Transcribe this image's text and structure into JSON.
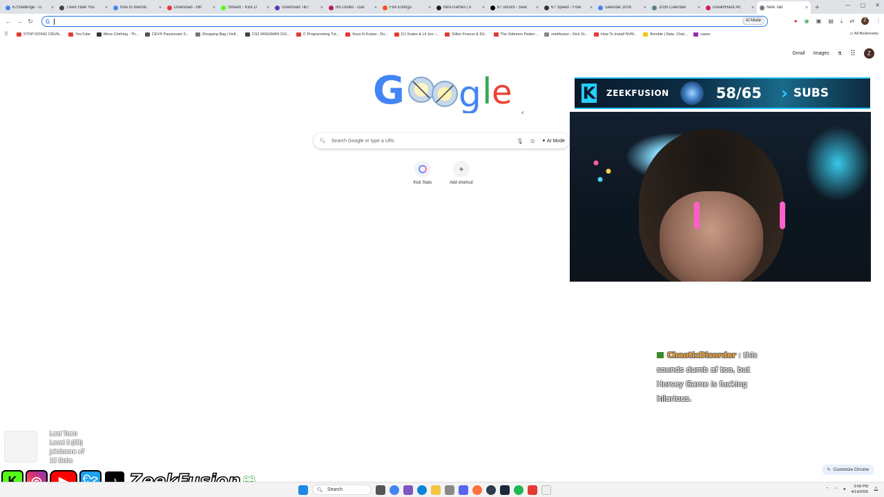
{
  "browser": {
    "tabs": [
      {
        "title": "67challenge - G",
        "color": "#4285f4"
      },
      {
        "title": "Trees Hate You",
        "color": "#444"
      },
      {
        "title": "how to downlo",
        "color": "#4285f4"
      },
      {
        "title": "Download - Mil",
        "color": "#e53935"
      },
      {
        "title": "Stream - Kick D",
        "color": "#53fc18"
      },
      {
        "title": "Download TikT",
        "color": "#5e35b1"
      },
      {
        "title": "IRLToolkit - Das",
        "color": "#c2185b"
      },
      {
        "title": "Fire Extingu",
        "color": "#f4511e"
      },
      {
        "title": "Mini-Games | k",
        "color": "#222"
      },
      {
        "title": "67 record - Sear",
        "color": "#000"
      },
      {
        "title": "67 Speed - Free",
        "color": "#333"
      },
      {
        "title": "calendar 2026",
        "color": "#4285f4"
      },
      {
        "title": "2026 Calendar",
        "color": "#607d8b"
      },
      {
        "title": "DreamHack Atl",
        "color": "#d81b60"
      },
      {
        "title": "New Tab",
        "color": "#777"
      }
    ],
    "omnibox": {
      "value": "",
      "ai_mode": "AI Mode"
    },
    "bookmarks": [
      {
        "label": "STOP DOING CRUN...",
        "color": "#e53935"
      },
      {
        "label": "YouTube",
        "color": "#e53935"
      },
      {
        "label": "Mens Clothing - Th...",
        "color": "#333"
      },
      {
        "label": "CEV® Passionate S...",
        "color": "#555"
      },
      {
        "label": "Shopping Bag | Holl...",
        "color": "#777"
      },
      {
        "label": "CS2 WINGMAN 2X2...",
        "color": "#444"
      },
      {
        "label": "C Programming Tut...",
        "color": "#e53935"
      },
      {
        "label": "Keys N Krates - Du...",
        "color": "#e53935"
      },
      {
        "label": "DJ Snake & Lil Jon -...",
        "color": "#e53935"
      },
      {
        "label": "Dillon Francis & Dil...",
        "color": "#e53935"
      },
      {
        "label": "The Sidemen Patien...",
        "color": "#e53935"
      },
      {
        "label": "zeekfusion - Kick St...",
        "color": "#888"
      },
      {
        "label": "How To Install NVM...",
        "color": "#e53935"
      },
      {
        "label": "Bumble | Date, Chat...",
        "color": "#f9c200"
      },
      {
        "label": "cases",
        "color": "#9c27b0"
      }
    ],
    "all_bookmarks": "All Bookmarks"
  },
  "google": {
    "gmail": "Gmail",
    "images": "Images",
    "avatar": "Z",
    "search_placeholder": "Search Google or type a URL",
    "ai_mode": "AI Mode",
    "shortcuts": [
      {
        "label": "Kick Stats",
        "icon": "kick-stats-icon"
      },
      {
        "label": "Add shortcut",
        "icon": "plus-icon"
      }
    ],
    "customize": "Customize Chrome"
  },
  "overlay": {
    "sub_goal": {
      "brand": "ZEEKFUSION",
      "count": "58/65",
      "label": "SUBS",
      "accent": "#23c3ff"
    },
    "chat": {
      "user": "ChaoticDisorder",
      "message": ": this sounds dumb af too, but Horsey Game is fucking hilarious."
    },
    "last_train": {
      "title": "Last Train",
      "level": "Level 3  (53)",
      "donor": "jskidmore x7",
      "subs": "12 Subs"
    },
    "social_name": "ZeekFusion"
  },
  "taskbar": {
    "search": "Search",
    "time": "9:58 PM",
    "date": "4/14/2026"
  }
}
